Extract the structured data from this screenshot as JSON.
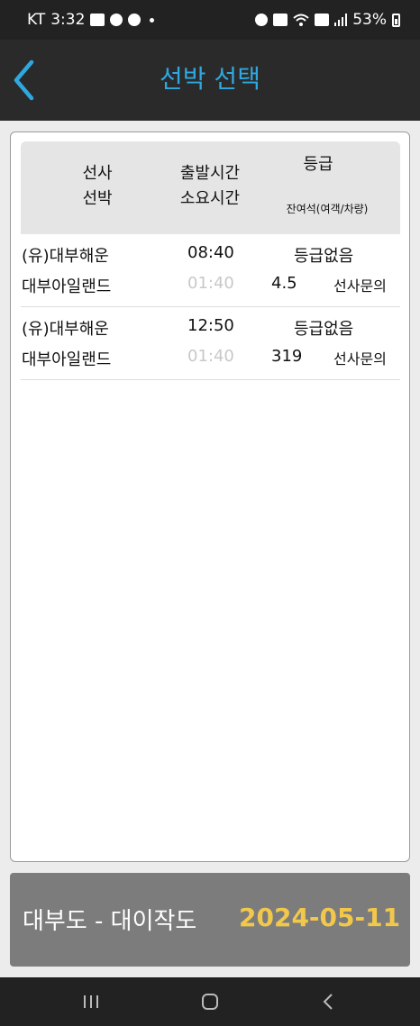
{
  "status_bar": {
    "carrier": "KT",
    "time": "3:32",
    "battery": "53%",
    "left_icons": [
      "gallery-icon",
      "cloud-icon",
      "chat-icon",
      "dot-icon"
    ],
    "right_icons": [
      "alarm-icon",
      "mute-icon",
      "wifi-icon",
      "hd-icon",
      "signal-icon",
      "battery-icon"
    ]
  },
  "header": {
    "title": "선박 선택",
    "back_icon": "chevron-left-icon",
    "title_color": "#2fa8e0"
  },
  "table": {
    "columns": {
      "company_line1": "선사",
      "company_line2": "선박",
      "time_line1": "출발시간",
      "time_line2": "소요시간",
      "grade_line1": "등급",
      "grade_line2": "잔여석(여객/차량)"
    },
    "rows": [
      {
        "company": "(유)대부해운",
        "ship": "대부아일랜드",
        "departure": "08:40",
        "duration": "01:40",
        "grade": "등급없음",
        "seats": "4.5",
        "contact": "선사문의"
      },
      {
        "company": "(유)대부해운",
        "ship": "대부아일랜드",
        "departure": "12:50",
        "duration": "01:40",
        "grade": "등급없음",
        "seats": "319",
        "contact": "선사문의"
      }
    ]
  },
  "footer": {
    "route": "대부도 - 대이작도",
    "date": "2024-05-11",
    "date_color": "#f2c84b"
  },
  "nav": {
    "icons": [
      "recent-apps-icon",
      "home-icon",
      "back-icon"
    ]
  }
}
